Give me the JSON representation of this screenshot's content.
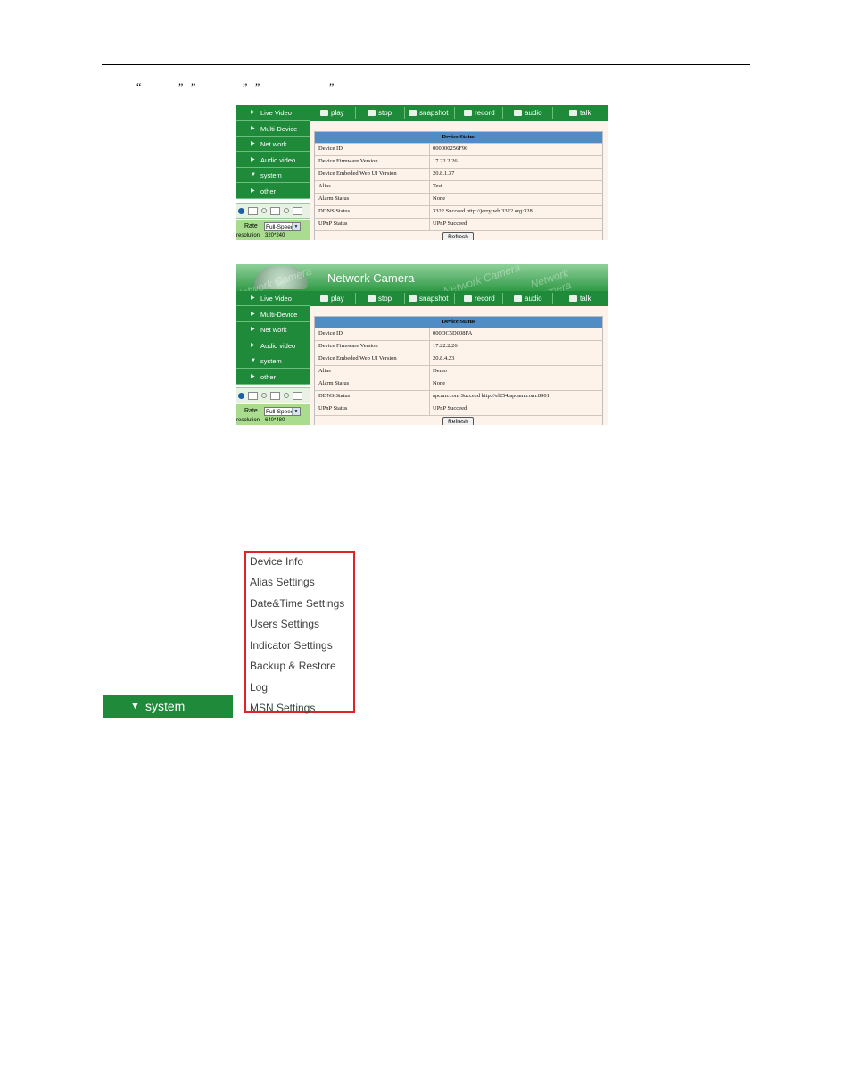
{
  "page": {
    "quote_line": [
      "“",
      "”",
      "”",
      "”",
      "”",
      "”"
    ]
  },
  "toolbar": [
    {
      "label": "play",
      "icon": "play-icon"
    },
    {
      "label": "stop",
      "icon": "stop-icon"
    },
    {
      "label": "snapshot",
      "icon": "camera-icon"
    },
    {
      "label": "record",
      "icon": "record-icon"
    },
    {
      "label": "audio",
      "icon": "audio-icon"
    },
    {
      "label": "talk",
      "icon": "microphone-icon"
    }
  ],
  "nav": [
    "Live Video",
    "Multi-Device",
    "Net work",
    "Audio video",
    "system",
    "other"
  ],
  "shot1": {
    "rate_label": "Rate",
    "rate_value": "Full-Speed",
    "resolution_label": "resolution",
    "resolution_value": "320*240",
    "table_title": "Device Status",
    "rows": [
      {
        "k": "Device ID",
        "v": "000000256F96"
      },
      {
        "k": "Device Firmware Version",
        "v": "17.22.2.26"
      },
      {
        "k": "Device Embeded Web UI Version",
        "v": "20.8.1.37"
      },
      {
        "k": "Alias",
        "v": "Test"
      },
      {
        "k": "Alarm Status",
        "v": "None"
      },
      {
        "k": "DDNS Status",
        "v": "3322 Succeed  http://jerryjwb.3322.org:328"
      },
      {
        "k": "UPnP Status",
        "v": "UPnP Succeed"
      }
    ],
    "refresh": "Refresh"
  },
  "shot2": {
    "banner_title": "Network Camera",
    "banner_watermark": "Network Camera",
    "rate_label": "Rate",
    "rate_value": "Full-Speed",
    "resolution_label": "resolution",
    "resolution_value": "640*480",
    "table_title": "Device Status",
    "rows": [
      {
        "k": "Device ID",
        "v": "000DC5D008FA"
      },
      {
        "k": "Device Firmware Version",
        "v": "17.22.2.26"
      },
      {
        "k": "Device Embeded Web UI Version",
        "v": "20.8.4.23"
      },
      {
        "k": "Alias",
        "v": "Demo"
      },
      {
        "k": "Alarm Status",
        "v": "None"
      },
      {
        "k": "DDNS Status",
        "v": "apcam.com  Succeed  http://el254.apcam.com:8901"
      },
      {
        "k": "UPnP Status",
        "v": "UPnP Succeed"
      }
    ],
    "refresh": "Refresh"
  },
  "system_menu": {
    "button_label": "system",
    "items": [
      "Device Info",
      "Alias Settings",
      "Date&Time Settings",
      "Users Settings",
      "Indicator Settings",
      "Backup & Restore",
      "Log",
      "MSN Settings"
    ]
  },
  "colors": {
    "nav_green": "#1f8a3a",
    "table_header_blue": "#4f8dc4",
    "panel_bg": "#fdf3ea",
    "highlight_red": "#e0222a"
  }
}
